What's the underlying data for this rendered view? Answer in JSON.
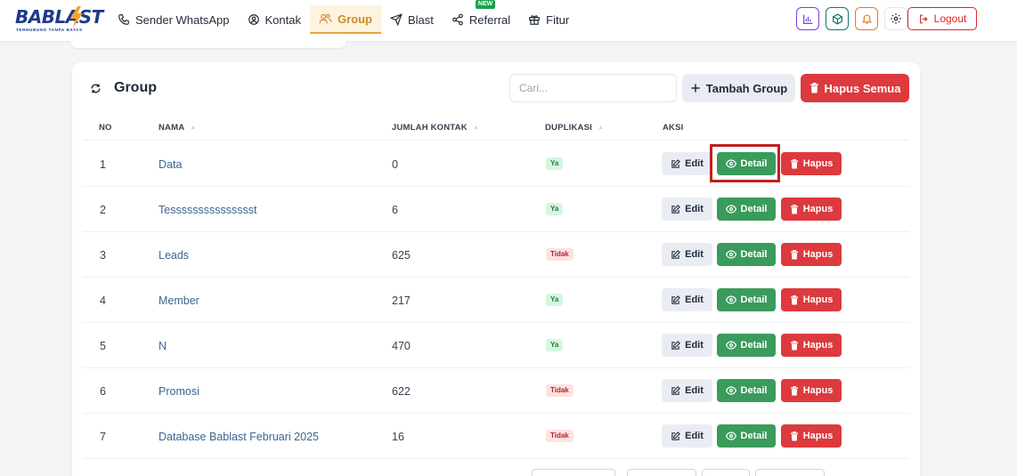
{
  "brand": {
    "name": "BABLAST",
    "tagline": "TERHUBUNG TANPA BATAS"
  },
  "nav": {
    "items": [
      {
        "label": "Sender WhatsApp",
        "icon": "phone-icon"
      },
      {
        "label": "Kontak",
        "icon": "user-circle-icon"
      },
      {
        "label": "Group",
        "icon": "users-icon"
      },
      {
        "label": "Blast",
        "icon": "send-icon"
      },
      {
        "label": "Referral",
        "icon": "share-icon",
        "badge": "NEW"
      },
      {
        "label": "Fitur",
        "icon": "gift-icon"
      }
    ],
    "active": "Group",
    "logout": "Logout"
  },
  "colors": {
    "accent": "#e9a23b",
    "success": "#3a9b5c",
    "danger": "#dc3a3e",
    "link": "#3b6592"
  },
  "card": {
    "title": "Group",
    "search_placeholder": "Cari...",
    "add_button": "Tambah Group",
    "delete_all_button": "Hapus Semua"
  },
  "table": {
    "headers": {
      "no": "NO",
      "nama": "NAMA",
      "jumlah": "JUMLAH KONTAK",
      "duplikasi": "DUPLIKASI",
      "aksi": "AKSI"
    },
    "actions": {
      "edit": "Edit",
      "detail": "Detail",
      "hapus": "Hapus"
    },
    "rows": [
      {
        "no": "1",
        "nama": "Data",
        "jumlah": "0",
        "duplikasi": "Ya"
      },
      {
        "no": "2",
        "nama": "Tessssssssssssssst",
        "jumlah": "6",
        "duplikasi": "Ya"
      },
      {
        "no": "3",
        "nama": "Leads",
        "jumlah": "625",
        "duplikasi": "Tidak"
      },
      {
        "no": "4",
        "nama": "Member",
        "jumlah": "217",
        "duplikasi": "Ya"
      },
      {
        "no": "5",
        "nama": "N",
        "jumlah": "470",
        "duplikasi": "Ya"
      },
      {
        "no": "6",
        "nama": "Promosi",
        "jumlah": "622",
        "duplikasi": "Tidak"
      },
      {
        "no": "7",
        "nama": "Database Bablast Februari 2025",
        "jumlah": "16",
        "duplikasi": "Tidak"
      }
    ]
  }
}
